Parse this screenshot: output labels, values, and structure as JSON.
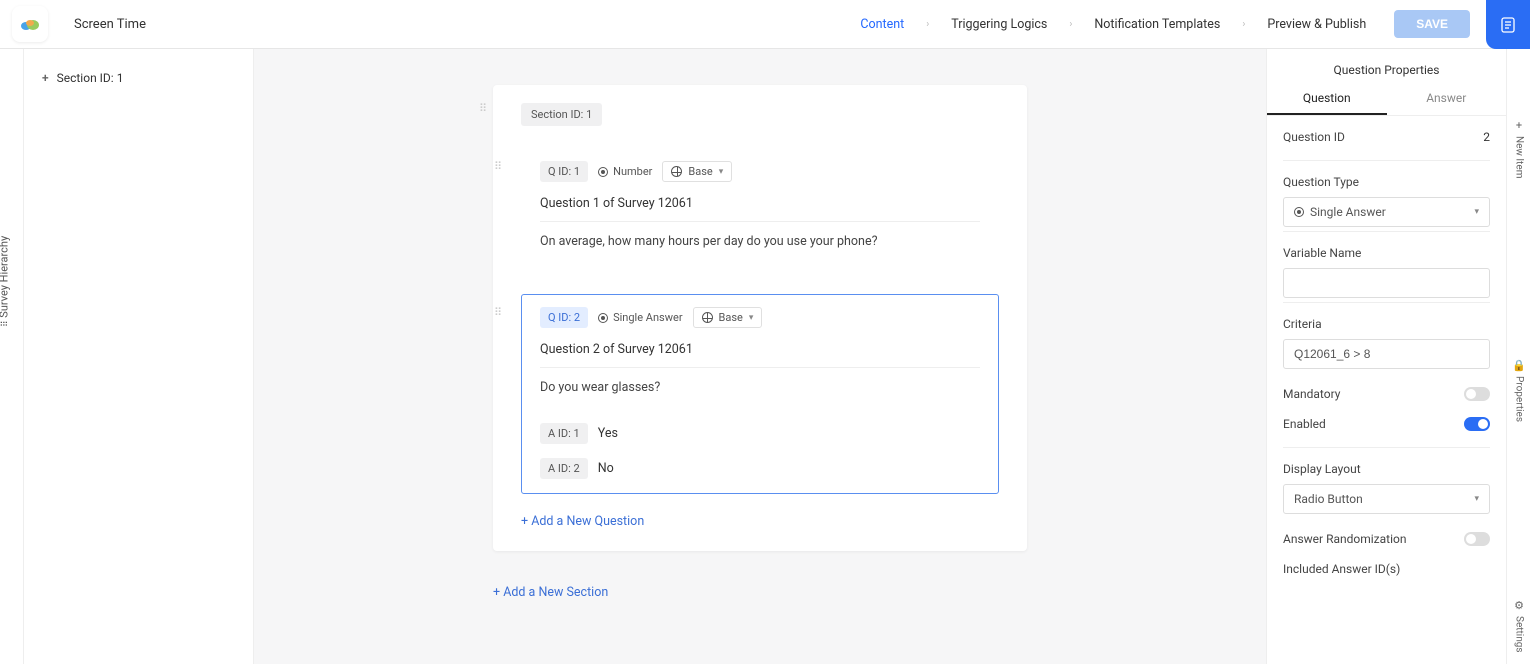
{
  "header": {
    "title": "Screen Time",
    "nav": [
      "Content",
      "Triggering Logics",
      "Notification Templates",
      "Preview & Publish"
    ],
    "activeNav": "Content",
    "saveLabel": "SAVE"
  },
  "leftRail": {
    "label": "Survey Hierarchy"
  },
  "hierarchy": {
    "items": [
      {
        "label": "Section ID: 1"
      }
    ]
  },
  "canvas": {
    "sectionBadge": "Section ID: 1",
    "questions": [
      {
        "qid": "Q ID: 1",
        "typeLabel": "Number",
        "lang": "Base",
        "title": "Question 1 of Survey 12061",
        "text": "On average, how many hours per day do you use your phone?",
        "selected": false,
        "answers": []
      },
      {
        "qid": "Q ID: 2",
        "typeLabel": "Single Answer",
        "lang": "Base",
        "title": "Question 2 of Survey 12061",
        "text": "Do you wear glasses?",
        "selected": true,
        "answers": [
          {
            "aid": "A ID: 1",
            "text": "Yes"
          },
          {
            "aid": "A ID: 2",
            "text": "No"
          }
        ]
      }
    ],
    "addQuestion": "+ Add a New Question",
    "addSection": "+ Add a New Section"
  },
  "properties": {
    "panelTitle": "Question Properties",
    "tabs": [
      "Question",
      "Answer"
    ],
    "activeTab": "Question",
    "questionIdLabel": "Question ID",
    "questionIdValue": "2",
    "questionTypeLabel": "Question Type",
    "questionTypeValue": "Single Answer",
    "variableNameLabel": "Variable Name",
    "variableNameValue": "",
    "criteriaLabel": "Criteria",
    "criteriaValue": "Q12061_6 > 8",
    "mandatoryLabel": "Mandatory",
    "mandatoryOn": false,
    "enabledLabel": "Enabled",
    "enabledOn": true,
    "displayLayoutLabel": "Display Layout",
    "displayLayoutValue": "Radio Button",
    "answerRandLabel": "Answer Randomization",
    "answerRandOn": false,
    "includedIdsLabel": "Included Answer ID(s)"
  },
  "rightRail": {
    "newItem": "New Item",
    "properties": "Properties",
    "settings": "Settings"
  }
}
